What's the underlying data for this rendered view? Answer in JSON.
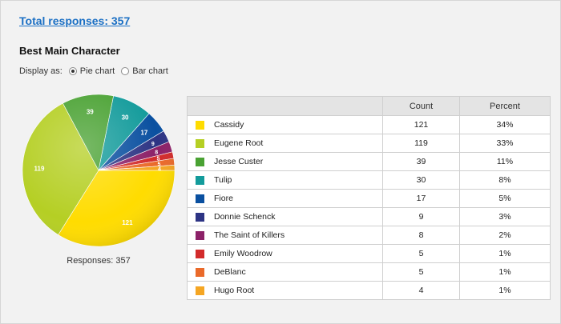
{
  "header": {
    "total_link": "Total responses: 357"
  },
  "question": {
    "title": "Best Main Character"
  },
  "display": {
    "label": "Display as:",
    "options": [
      {
        "label": "Pie chart",
        "selected": true
      },
      {
        "label": "Bar chart",
        "selected": false
      }
    ]
  },
  "table": {
    "headers": {
      "count": "Count",
      "percent": "Percent"
    },
    "rows": [
      {
        "name": "Cassidy",
        "count": "121",
        "percent": "34%",
        "color": "#ffdc00"
      },
      {
        "name": "Eugene Root",
        "count": "119",
        "percent": "33%",
        "color": "#b5cf24"
      },
      {
        "name": "Jesse Custer",
        "count": "39",
        "percent": "11%",
        "color": "#4aa233"
      },
      {
        "name": "Tulip",
        "count": "30",
        "percent": "8%",
        "color": "#139b9b"
      },
      {
        "name": "Fiore",
        "count": "17",
        "percent": "5%",
        "color": "#0a50a0"
      },
      {
        "name": "Donnie Schenck",
        "count": "9",
        "percent": "3%",
        "color": "#2d3484"
      },
      {
        "name": "The Saint of Killers",
        "count": "8",
        "percent": "2%",
        "color": "#8c2168"
      },
      {
        "name": "Emily Woodrow",
        "count": "5",
        "percent": "1%",
        "color": "#d22b2b"
      },
      {
        "name": "DeBlanc",
        "count": "5",
        "percent": "1%",
        "color": "#ea6a2a"
      },
      {
        "name": "Hugo Root",
        "count": "4",
        "percent": "1%",
        "color": "#f5a623"
      }
    ]
  },
  "chart_caption": "Responses: 357",
  "chart_data": {
    "type": "pie",
    "categories": [
      "Cassidy",
      "Eugene Root",
      "Jesse Custer",
      "Tulip",
      "Fiore",
      "Donnie Schenck",
      "The Saint of Killers",
      "Emily Woodrow",
      "DeBlanc",
      "Hugo Root"
    ],
    "values": [
      121,
      119,
      39,
      30,
      17,
      9,
      8,
      5,
      5,
      4
    ],
    "data_labels": [
      "121",
      "119",
      "39",
      "30",
      "17",
      "9",
      "8",
      "5",
      "5",
      "4"
    ],
    "colors": [
      "#ffdc00",
      "#b5cf24",
      "#4aa233",
      "#139b9b",
      "#0a50a0",
      "#2d3484",
      "#8c2168",
      "#d22b2b",
      "#ea6a2a",
      "#f5a623"
    ],
    "legend": "table-right"
  }
}
